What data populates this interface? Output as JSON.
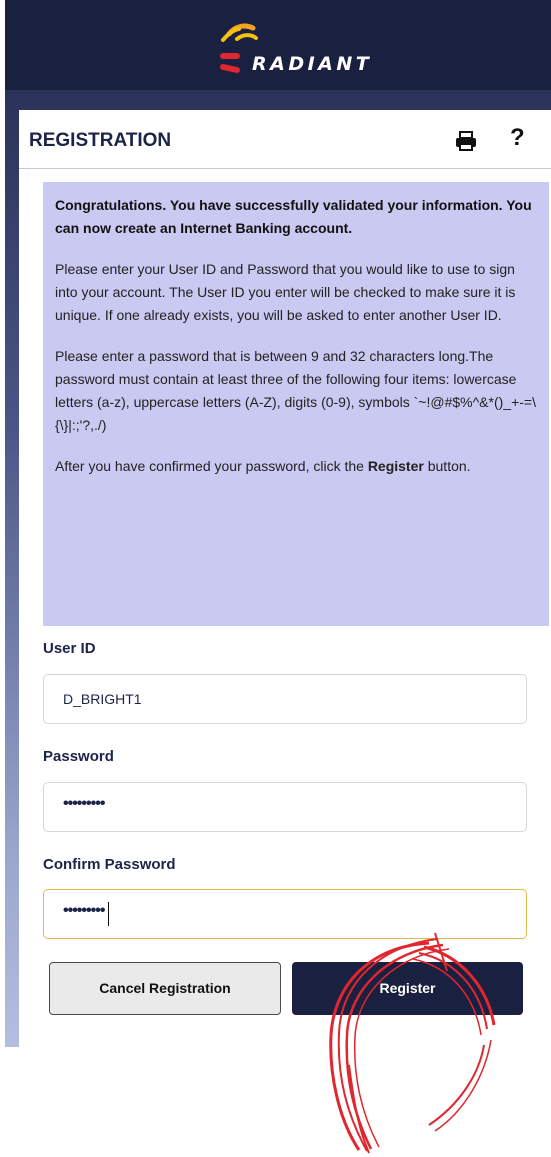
{
  "brand": {
    "name": "RADIANT"
  },
  "panel": {
    "title": "REGISTRATION"
  },
  "icons": {
    "print": "print-icon",
    "help": "help-icon",
    "help_glyph": "?"
  },
  "info": {
    "heading": "Congratulations. You have successfully validated your information. You can now create an Internet Banking account.",
    "para1": "Please enter your User ID and Password that you would like to use to sign into your account. The User ID you enter will be checked to make sure it is unique. If one already exists, you will be asked to enter another User ID.",
    "para2": "Please enter a password that is between 9 and 32 characters long.The password must contain at least three of the following four items: lowercase letters (a-z), uppercase letters (A-Z), digits (0-9), symbols `~!@#$%^&*()_+-=\\{\\}|:;'?,./)",
    "para3_before": "After you have confirmed your password, click the ",
    "para3_bold": "Register",
    "para3_after": " button."
  },
  "form": {
    "user_id": {
      "label": "User ID",
      "value": "D_BRIGHT1"
    },
    "password": {
      "label": "Password",
      "value": "•••••••••"
    },
    "confirm_password": {
      "label": "Confirm Password",
      "value": "•••••••••"
    }
  },
  "buttons": {
    "cancel": "Cancel Registration",
    "register": "Register"
  },
  "colors": {
    "header": "#1a2040",
    "info_box": "#c9c9f2",
    "focus_border": "#e2b84a",
    "annotation": "#e0262e"
  }
}
